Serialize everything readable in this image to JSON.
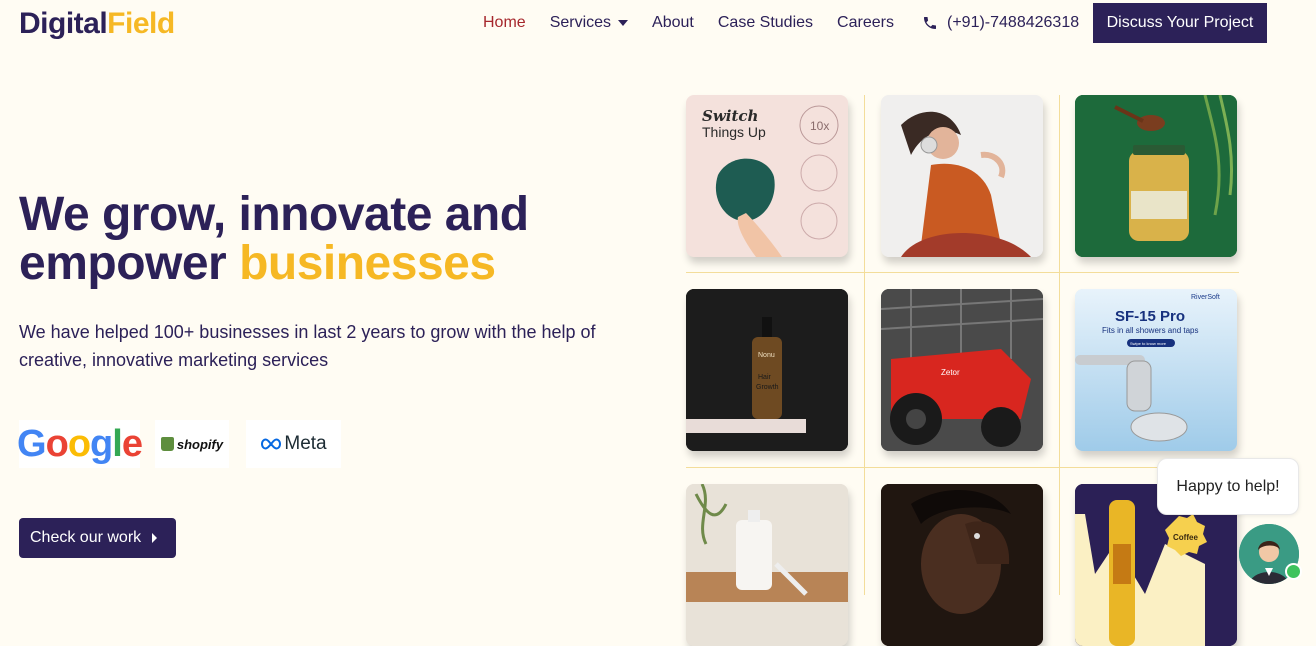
{
  "brand": {
    "part1": "Digital",
    "part2": "Field",
    "accent": "#f6b824",
    "primary": "#2c2158"
  },
  "nav": {
    "home": "Home",
    "services": "Services",
    "about": "About",
    "case_studies": "Case Studies",
    "careers": "Careers",
    "active_color": "#a6272c"
  },
  "contact": {
    "phone": "(+91)-7488426318",
    "icon": "phone-icon"
  },
  "header_cta": "Discuss Your Project",
  "hero": {
    "line1": "We grow, innovate and",
    "line2_prefix": "empower ",
    "line2_highlight": "businesses",
    "subtitle": "We have helped 100+ businesses in last 2 years to grow with the help of creative, innovative marketing services",
    "cta": "Check our work"
  },
  "partners": {
    "google": [
      "G",
      "o",
      "o",
      "g",
      "l",
      "e"
    ],
    "shopify": "shopify",
    "meta": "Meta"
  },
  "gallery": {
    "switch_title": "Switch",
    "switch_sub": "Things Up",
    "switch_badge": "10x",
    "bottle_label1": "Nonu",
    "bottle_label2": "Hair",
    "bottle_label3": "Growth",
    "tractor_brand": "Zetor",
    "shower_brand": "RiverSoft",
    "shower_title": "SF-15 Pro",
    "shower_sub": "Fits in all showers and taps",
    "shower_btn": "Swipe to know more",
    "coffee_badge": "Coffee"
  },
  "chat": {
    "message": "Happy to help!"
  }
}
